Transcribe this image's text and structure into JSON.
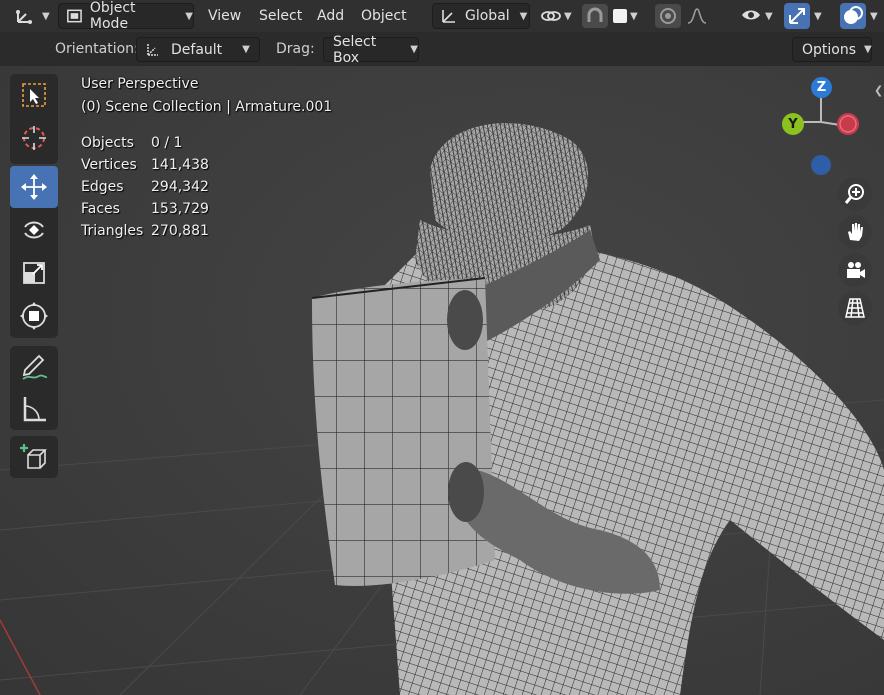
{
  "header": {
    "editor_type_icon": "axes-grid-icon",
    "mode_label": "Object Mode",
    "menus": [
      "View",
      "Select",
      "Add",
      "Object"
    ],
    "transform_label": "Global",
    "icons": [
      "link-icon",
      "snap-magnet-icon",
      "square-icon",
      "proportional-edit-icon",
      "falloff-curve-icon",
      "eye-visibility-icon",
      "gizmo-icon",
      "overlays-icon"
    ]
  },
  "tool_header": {
    "orientation_label": "Orientation:",
    "orientation_value": "Default",
    "drag_label": "Drag:",
    "drag_value": "Select Box",
    "options_label": "Options"
  },
  "viewport": {
    "view_name": "User Perspective",
    "collection": "(0) Scene Collection | Armature.001",
    "stats": [
      {
        "label": "Objects",
        "value": "0 / 1"
      },
      {
        "label": "Vertices",
        "value": "141,438"
      },
      {
        "label": "Edges",
        "value": "294,342"
      },
      {
        "label": "Faces",
        "value": "153,729"
      },
      {
        "label": "Triangles",
        "value": "270,881"
      }
    ]
  },
  "gizmo": {
    "z": "Z",
    "y": "Y",
    "colors": {
      "z": "#2b7bd6",
      "y": "#8cc21f",
      "x": "#c93a4b"
    }
  },
  "tools": [
    "select-box-tool",
    "cursor-tool",
    "move-tool",
    "rotate-tool",
    "scale-tool",
    "transform-tool",
    "annotate-tool",
    "measure-tool",
    "add-cube-tool"
  ],
  "nav_buttons": [
    "zoom-icon",
    "pan-hand-icon",
    "camera-icon",
    "perspective-grid-icon"
  ],
  "colors": {
    "accent": "#4772b3",
    "header": "#303030",
    "viewport": "#3d3d3d"
  }
}
